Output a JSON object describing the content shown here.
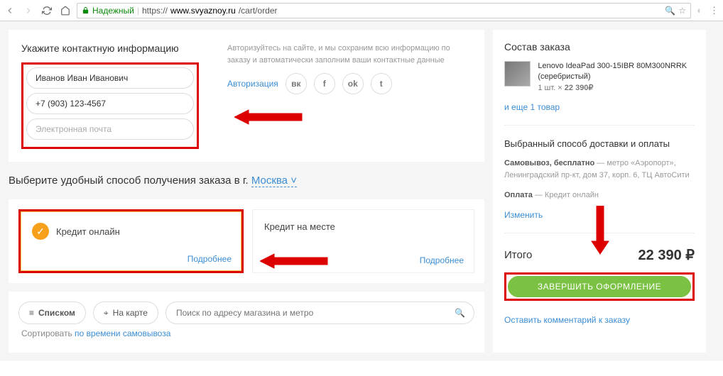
{
  "browser": {
    "secure_label": "Надежный",
    "url_prefix": "https://",
    "url_host": "www.svyaznoy.ru",
    "url_path": "/cart/order"
  },
  "contact": {
    "title": "Укажите контактную информацию",
    "name_value": "Иванов Иван Иванович",
    "phone_value": "+7 (903) 123-4567",
    "email_placeholder": "Электронная почта",
    "auth_hint": "Авторизуйтесь на сайте, и мы сохраним всю информацию по заказу и автоматически заполним ваши контактные данные",
    "auth_link": "Авторизация"
  },
  "social": {
    "vk": "вк",
    "fb": "f",
    "ok": "ok",
    "tw": "t"
  },
  "delivery": {
    "header_prefix": "Выберите удобный способ получения заказа в г. ",
    "city": "Москва",
    "city_caret": "˅"
  },
  "payment": {
    "opt1": "Кредит онлайн",
    "opt2": "Кредит на месте",
    "details": "Подробнее"
  },
  "view": {
    "list": "Списком",
    "map": "На карте",
    "search_placeholder": "Поиск по адресу магазина и метро",
    "sort_prefix": "Сортировать ",
    "sort_link": "по времени самовывоза"
  },
  "order": {
    "title": "Состав заказа",
    "product_name": "Lenovo IdeaPad 300-15IBR 80M300NRRK (серебристый)",
    "product_qty": "1 шт. × ",
    "product_price": "22 390₽",
    "more": "и еще 1 товар",
    "delivery_title": "Выбранный способ доставки и оплаты",
    "pickup_label": "Самовывоз, бесплатно",
    "pickup_addr": " — метро «Аэропорт», Ленинградский пр-кт, дом 37, корп. 6, ТЦ АвтоСити",
    "payment_label": "Оплата",
    "payment_val": " — Кредит онлайн",
    "change": "Изменить",
    "total_label": "Итого",
    "total_value": "22 390 ₽",
    "complete": "ЗАВЕРШИТЬ ОФОРМЛЕНИЕ",
    "comment": "Оставить комментарий к заказу"
  }
}
